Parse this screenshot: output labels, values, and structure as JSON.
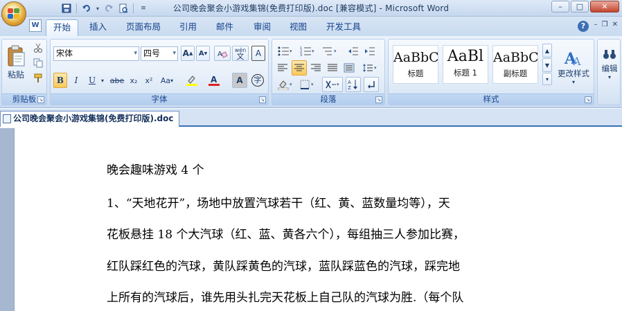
{
  "window": {
    "title": "公司晚会聚会小游戏集锦(免费打印版).doc [兼容模式] - Microsoft Word",
    "min_label": "–",
    "max_label": "□",
    "close_label": "✕"
  },
  "quick_access": {
    "save_icon": "save-icon",
    "undo_icon": "undo-icon",
    "redo_icon": "redo-icon",
    "print_preview_icon": "print-preview-icon",
    "customize_icon": "chevron-down-icon"
  },
  "tabs": [
    {
      "label": "开始",
      "active": true
    },
    {
      "label": "插入"
    },
    {
      "label": "页面布局"
    },
    {
      "label": "引用"
    },
    {
      "label": "邮件"
    },
    {
      "label": "审阅"
    },
    {
      "label": "视图"
    },
    {
      "label": "开发工具"
    }
  ],
  "ribbon": {
    "clipboard": {
      "label": "剪贴板",
      "paste_label": "粘贴"
    },
    "font": {
      "label": "字体",
      "font_name": "宋体",
      "font_size": "四号",
      "bold": "B",
      "italic": "I",
      "underline": "U",
      "strike": "abe",
      "subscript": "x₂",
      "superscript": "x²",
      "change_case": "Aa",
      "grow": "A",
      "shrink": "A",
      "phonetic": "wén",
      "char_border": "A",
      "char_shading": "A",
      "enclosed": "字"
    },
    "paragraph": {
      "label": "段落"
    },
    "styles": {
      "label": "样式",
      "items": [
        {
          "sample": "AaBbC",
          "name": "标题"
        },
        {
          "sample": "AaBl",
          "name": "标题 1"
        },
        {
          "sample": "AaBbC",
          "name": "副标题"
        }
      ],
      "change_styles_label": "更改样式"
    },
    "editing": {
      "label": "编辑"
    }
  },
  "doc_tab": {
    "label": "公司晚会聚会小游戏集锦(免费打印版).doc"
  },
  "document": {
    "lines": [
      "晚会趣味游戏 4 个",
      "1、“天地花开”，场地中放置汽球若干（红、黄、蓝数量均等），天",
      "花板悬挂 18 个大汽球（红、蓝、黄各六个），每组抽三人参加比赛，",
      "红队踩红色的汽球，黄队踩黄色的汽球，蓝队踩蓝色的汽球，踩完地",
      "上所有的汽球后，谁先用头扎完天花板上自己队的汽球为胜.（每个队"
    ]
  },
  "colors": {
    "accent": "#15428b",
    "ribbon_bg": "#dae7f6",
    "highlight": "#f8c95c"
  }
}
